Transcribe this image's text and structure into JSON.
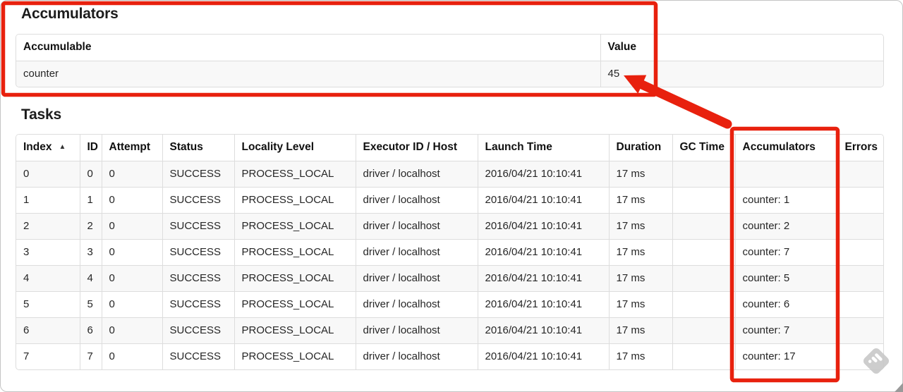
{
  "accumulators_section": {
    "heading": "Accumulators",
    "table": {
      "headers": [
        "Accumulable",
        "Value"
      ],
      "rows": [
        [
          "counter",
          "45"
        ]
      ]
    }
  },
  "tasks_section": {
    "heading": "Tasks",
    "sort_icon": "▲",
    "table": {
      "headers": [
        "Index",
        "ID",
        "Attempt",
        "Status",
        "Locality Level",
        "Executor ID / Host",
        "Launch Time",
        "Duration",
        "GC Time",
        "Accumulators",
        "Errors"
      ],
      "rows": [
        [
          "0",
          "0",
          "0",
          "SUCCESS",
          "PROCESS_LOCAL",
          "driver / localhost",
          "2016/04/21 10:10:41",
          "17 ms",
          "",
          "",
          ""
        ],
        [
          "1",
          "1",
          "0",
          "SUCCESS",
          "PROCESS_LOCAL",
          "driver / localhost",
          "2016/04/21 10:10:41",
          "17 ms",
          "",
          "counter: 1",
          ""
        ],
        [
          "2",
          "2",
          "0",
          "SUCCESS",
          "PROCESS_LOCAL",
          "driver / localhost",
          "2016/04/21 10:10:41",
          "17 ms",
          "",
          "counter: 2",
          ""
        ],
        [
          "3",
          "3",
          "0",
          "SUCCESS",
          "PROCESS_LOCAL",
          "driver / localhost",
          "2016/04/21 10:10:41",
          "17 ms",
          "",
          "counter: 7",
          ""
        ],
        [
          "4",
          "4",
          "0",
          "SUCCESS",
          "PROCESS_LOCAL",
          "driver / localhost",
          "2016/04/21 10:10:41",
          "17 ms",
          "",
          "counter: 5",
          ""
        ],
        [
          "5",
          "5",
          "0",
          "SUCCESS",
          "PROCESS_LOCAL",
          "driver / localhost",
          "2016/04/21 10:10:41",
          "17 ms",
          "",
          "counter: 6",
          ""
        ],
        [
          "6",
          "6",
          "0",
          "SUCCESS",
          "PROCESS_LOCAL",
          "driver / localhost",
          "2016/04/21 10:10:41",
          "17 ms",
          "",
          "counter: 7",
          ""
        ],
        [
          "7",
          "7",
          "0",
          "SUCCESS",
          "PROCESS_LOCAL",
          "driver / localhost",
          "2016/04/21 10:10:41",
          "17 ms",
          "",
          "counter: 17",
          ""
        ]
      ]
    }
  },
  "annotations": {
    "red_color": "#e8210e"
  },
  "watermark": {
    "diamond_color": "#c9c9c9",
    "glyph_color": "#ffffff",
    "corner_color": "#9a9a9a"
  }
}
